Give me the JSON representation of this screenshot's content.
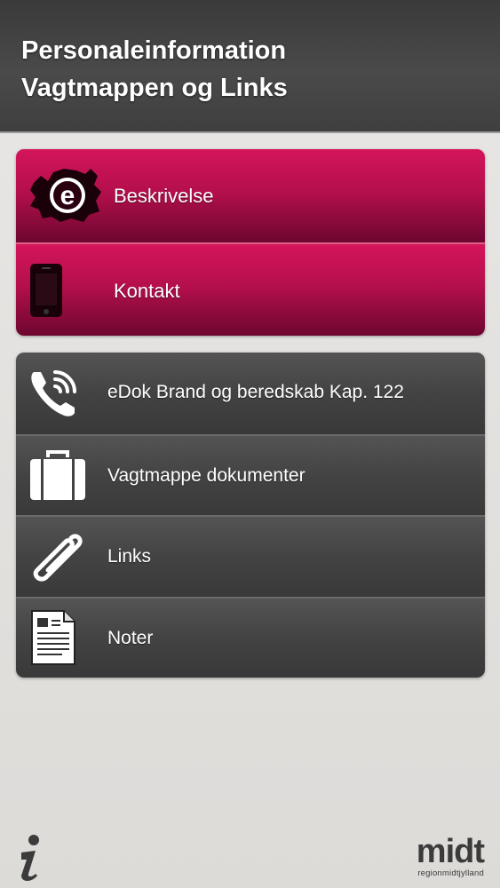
{
  "header": {
    "title_line1": "Personaleinformation",
    "title_line2": "Vagtmappen og Links"
  },
  "primary_menu": [
    {
      "label": "Beskrivelse",
      "icon": "e-logo-icon"
    },
    {
      "label": "Kontakt",
      "icon": "phone-icon"
    }
  ],
  "secondary_menu": [
    {
      "label": "eDok Brand og beredskab Kap. 122",
      "icon": "phone-call-icon"
    },
    {
      "label": "Vagtmappe dokumenter",
      "icon": "briefcase-icon"
    },
    {
      "label": "Links",
      "icon": "paperclip-icon"
    },
    {
      "label": "Noter",
      "icon": "document-icon"
    }
  ],
  "footer": {
    "info_icon": "info-icon",
    "logo_text": "midt",
    "logo_subtext": "regionmidtjylland"
  },
  "colors": {
    "primary_menu": "#b50f4d",
    "secondary_menu": "#434343",
    "header": "#3f3f3f"
  }
}
